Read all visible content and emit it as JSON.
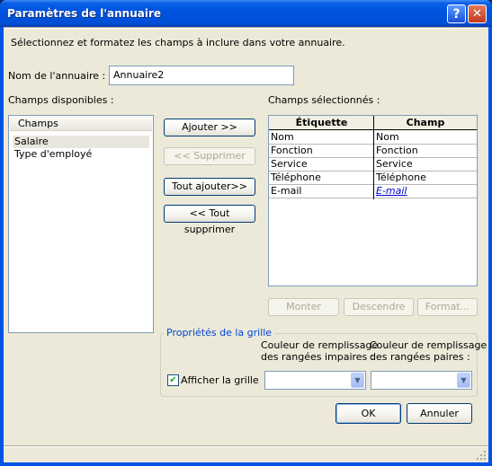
{
  "window": {
    "title": "Paramètres de l'annuaire",
    "help_symbol": "?",
    "close_symbol": "✕"
  },
  "intro_text": "Sélectionnez et formatez les champs à inclure dans votre annuaire.",
  "directory_name": {
    "label": "Nom de l'annuaire :",
    "value": "Annuaire2"
  },
  "available_fields": {
    "label": "Champs disponibles :",
    "header": "Champs",
    "items": [
      "Salaire",
      "Type d'employé"
    ],
    "selected_index": 0
  },
  "middle_buttons": {
    "add": "Ajouter >>",
    "remove": "<< Supprimer",
    "add_all": "Tout ajouter>>",
    "remove_all": "<< Tout supprimer"
  },
  "selected_fields": {
    "label": "Champs sélectionnés :",
    "columns": [
      "Étiquette",
      "Champ"
    ],
    "rows": [
      {
        "label": "Nom",
        "field": "Nom"
      },
      {
        "label": "Fonction",
        "field": "Fonction"
      },
      {
        "label": "Service",
        "field": "Service"
      },
      {
        "label": "Téléphone",
        "field": "Téléphone"
      },
      {
        "label": "E-mail",
        "field": "E-mail"
      }
    ],
    "link_color": "#0000cc"
  },
  "order_buttons": {
    "up": "Monter",
    "down": "Descendre",
    "format": "Format..."
  },
  "grid_properties": {
    "title": "Propriétés de la grille",
    "show_grid_label": "Afficher la grille",
    "show_grid_checked": true,
    "odd_rows_label_line1": "Couleur de remplissage",
    "odd_rows_label_line2": "des rangées impaires :",
    "even_rows_label_line1": "Couleur de remplissage",
    "even_rows_label_line2": "des rangées paires :",
    "odd_rows_value": "",
    "even_rows_value": ""
  },
  "footer_buttons": {
    "ok": "OK",
    "cancel": "Annuler"
  },
  "icons": {
    "check": "✔",
    "dropdown": "▼"
  },
  "colors": {
    "titlebar": "#0054e3",
    "client": "#ece9d8",
    "group_title": "#0046d5"
  }
}
